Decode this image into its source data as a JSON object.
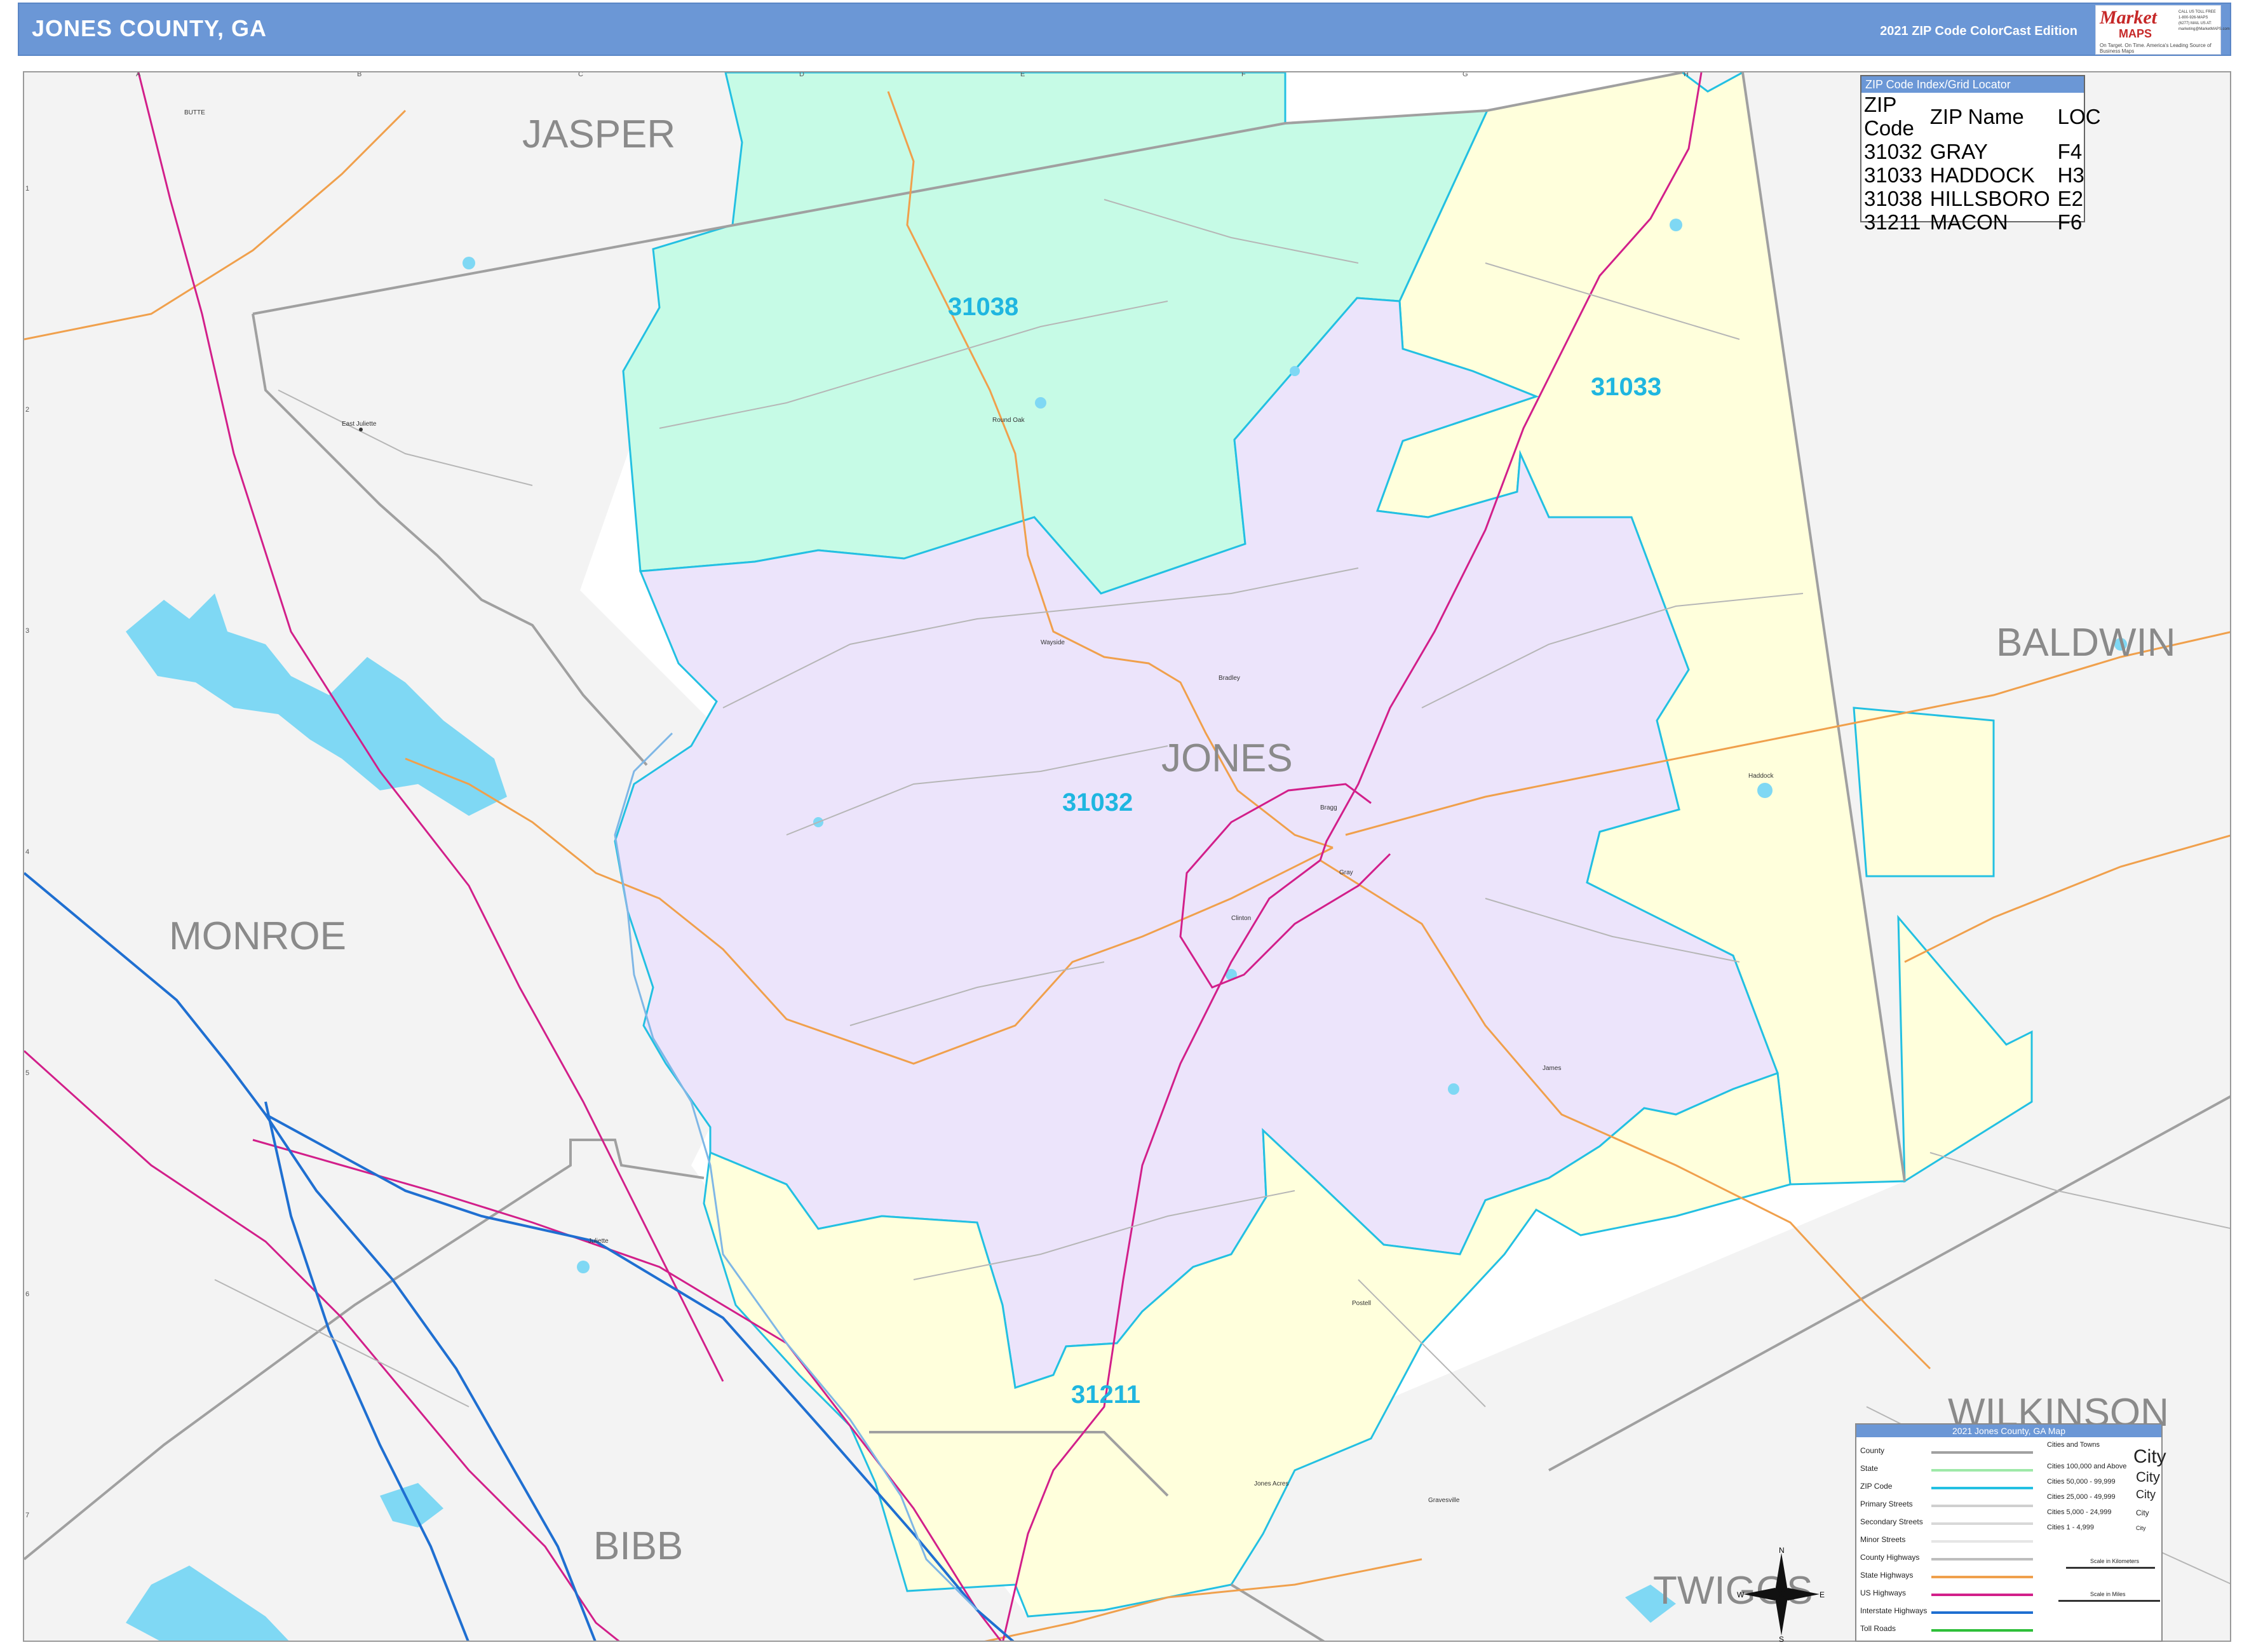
{
  "header": {
    "title": "JONES COUNTY, GA",
    "edition": "2021 ZIP Code ColorCast Edition",
    "logo": {
      "m": "Market",
      "maps": "MAPS",
      "tagline": "On Target. On Time. America's Leading Source of Business Maps",
      "side": "CALL US TOLL FREE 1-800-926-MAPS (6277) MAIL US AT: marketing@MarketMAPS.com"
    }
  },
  "grid": {
    "columns": [
      "A",
      "B",
      "C",
      "D",
      "E",
      "F",
      "G",
      "H"
    ],
    "rows": [
      "1",
      "2",
      "3",
      "4",
      "5",
      "6",
      "7"
    ]
  },
  "counties": {
    "jasper": "JASPER",
    "baldwin": "BALDWIN",
    "jones": "JONES",
    "monroe": "MONROE",
    "wilkinson": "WILKINSON",
    "bibb": "BIBB",
    "twiggs": "TWIGGS"
  },
  "zips": {
    "z31038": "31038",
    "z31033": "31033",
    "z31032": "31032",
    "z31211": "31211"
  },
  "towns": {
    "butte": "BUTTE",
    "round_oak": "Round Oak",
    "east_juliette": "East Juliette",
    "wayside": "Wayside",
    "bradley": "Bradley",
    "haddock": "Haddock",
    "bragg": "Bragg",
    "gray": "Gray",
    "clinton": "Clinton",
    "james": "James",
    "postell": "Postell",
    "juliette": "Juliette",
    "jones_acres": "Jones Acres",
    "gravesville": "Gravesville"
  },
  "index": {
    "title": "ZIP Code Index/Grid Locator",
    "headers": [
      "ZIP Code",
      "ZIP Name",
      "LOC"
    ],
    "rows": [
      [
        "31032",
        "GRAY",
        "F4"
      ],
      [
        "31033",
        "HADDOCK",
        "H3"
      ],
      [
        "31038",
        "HILLSBORO",
        "E2"
      ],
      [
        "31211",
        "MACON",
        "F6"
      ]
    ]
  },
  "legend": {
    "title": "2021 Jones County, GA Map",
    "items": [
      "County",
      "State",
      "ZIP Code",
      "Primary Streets",
      "Secondary Streets",
      "Minor Streets",
      "County Highways",
      "State Highways",
      "US Highways",
      "Interstate Highways",
      "Toll Roads"
    ],
    "cities_title": "Cities and Towns",
    "city_classes": [
      "Cities 100,000 and Above",
      "Cities 50,000 - 99,999",
      "Cities 25,000 - 49,999",
      "Cities 5,000 - 24,999",
      "Cities 1 - 4,999"
    ],
    "city_samples": [
      "City",
      "City",
      "City",
      "City",
      "City"
    ],
    "scale_km": "Scale in Kilometers",
    "scale_mi": "Scale in Miles",
    "compass": {
      "n": "N",
      "s": "S",
      "e": "E",
      "w": "W"
    }
  },
  "colors": {
    "header": "#6b97d6",
    "zip31038": "#c6fbe6",
    "zip31033": "#ffffdc",
    "zip31032": "#ece4fb",
    "zip31211": "#ffffdc",
    "zip_border": "#23c0e2",
    "us_highway": "#d21f8a",
    "interstate": "#1f6fd1",
    "state_highway": "#f0a04c",
    "water": "#7fd8f4"
  }
}
